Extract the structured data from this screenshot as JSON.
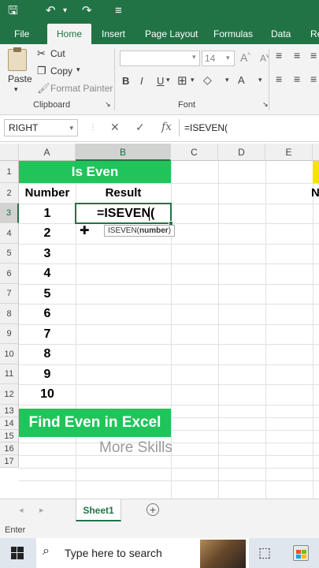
{
  "menu": {
    "file": "File",
    "home": "Home",
    "insert": "Insert",
    "page_layout": "Page Layout",
    "formulas": "Formulas",
    "data": "Data",
    "review": "Re"
  },
  "clipboard": {
    "paste": "Paste",
    "cut": "Cut",
    "copy": "Copy",
    "format_painter": "Format Painter",
    "group_label": "Clipboard"
  },
  "font": {
    "size": "14",
    "group_label": "Font"
  },
  "formula_bar": {
    "name_box": "RIGHT",
    "formula": "=ISEVEN("
  },
  "columns": [
    "A",
    "B",
    "C",
    "D",
    "E"
  ],
  "rows": [
    "1",
    "2",
    "3",
    "4",
    "5",
    "6",
    "7",
    "8",
    "9",
    "10",
    "11",
    "12",
    "13",
    "14",
    "15",
    "16",
    "17"
  ],
  "sheet": {
    "title": "Is Even",
    "header_number": "Number",
    "header_result": "Result",
    "numbers": [
      "1",
      "2",
      "3",
      "4",
      "5",
      "6",
      "7",
      "8",
      "9",
      "10"
    ],
    "active_cell_text": "=ISEVEN(",
    "tooltip_fn": "ISEVEN(",
    "tooltip_arg": "number",
    "tooltip_close": ")",
    "banner": "Find Even in Excel",
    "watermark": "More Skills",
    "partial_header": "N"
  },
  "sheet_tab": "Sheet1",
  "status": "Enter",
  "taskbar": {
    "search_placeholder": "Type here to search"
  },
  "colors": {
    "excel_green": "#217346",
    "banner_green": "#21c45a",
    "highlight_yellow": "#f5e400"
  }
}
